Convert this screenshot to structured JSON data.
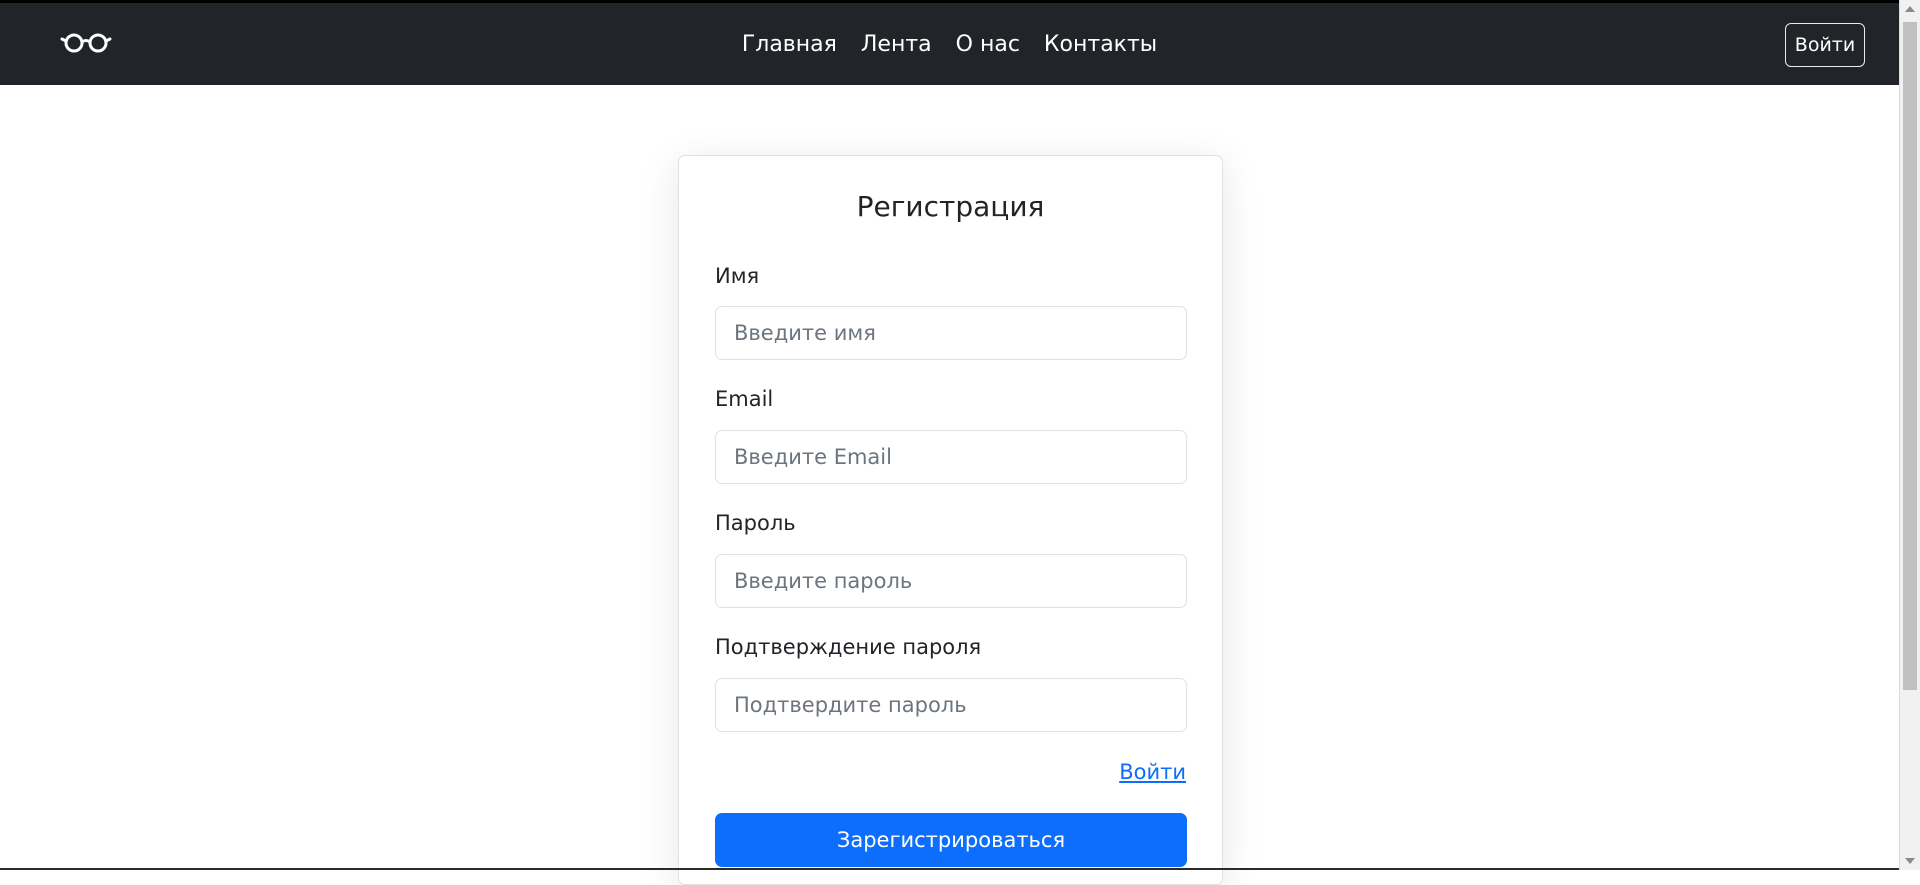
{
  "navbar": {
    "logo_icon": "glasses-icon",
    "links": [
      "Главная",
      "Лента",
      "О нас",
      "Контакты"
    ],
    "login_button": "Войти"
  },
  "form": {
    "title": "Регистрация",
    "fields": [
      {
        "label": "Имя",
        "placeholder": "Введите имя",
        "value": ""
      },
      {
        "label": "Email",
        "placeholder": "Введите Email",
        "value": ""
      },
      {
        "label": "Пароль",
        "placeholder": "Введите пароль",
        "value": ""
      },
      {
        "label": "Подтверждение пароля",
        "placeholder": "Подтвердите пароль",
        "value": ""
      }
    ],
    "login_link": "Войти",
    "submit_button": "Зарегистрироваться"
  },
  "colors": {
    "navbar_bg": "#212529",
    "primary": "#0d6efd",
    "link": "#0d6efd"
  }
}
